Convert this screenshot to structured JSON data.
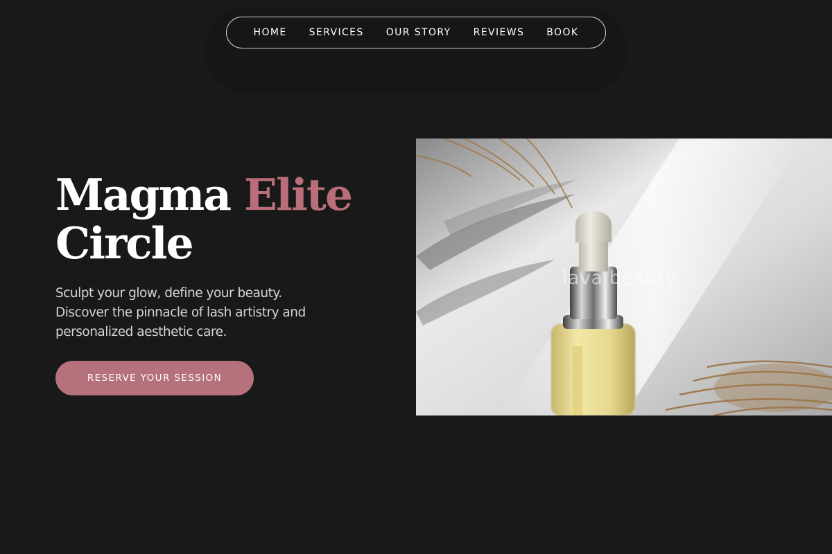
{
  "nav": {
    "items": [
      {
        "label": "HOME"
      },
      {
        "label": "SERVICES"
      },
      {
        "label": "OUR STORY"
      },
      {
        "label": "REVIEWS"
      },
      {
        "label": "BOOK"
      }
    ]
  },
  "hero": {
    "title_part1": "Magma",
    "title_accent": "Elite",
    "title_part2": "Circle",
    "subtitle_lines": [
      "Sculpt your glow, define your beauty.",
      "Discover the pinnacle of lash artistry and",
      "personalized aesthetic care."
    ],
    "cta_label": "RESERVE YOUR SESSION",
    "image_watermark": "lava beauty"
  },
  "colors": {
    "background": "#191919",
    "accent": "#b96e7a",
    "button": "#b5717c",
    "text": "#ffffff",
    "muted_text": "#d6d6d6"
  }
}
